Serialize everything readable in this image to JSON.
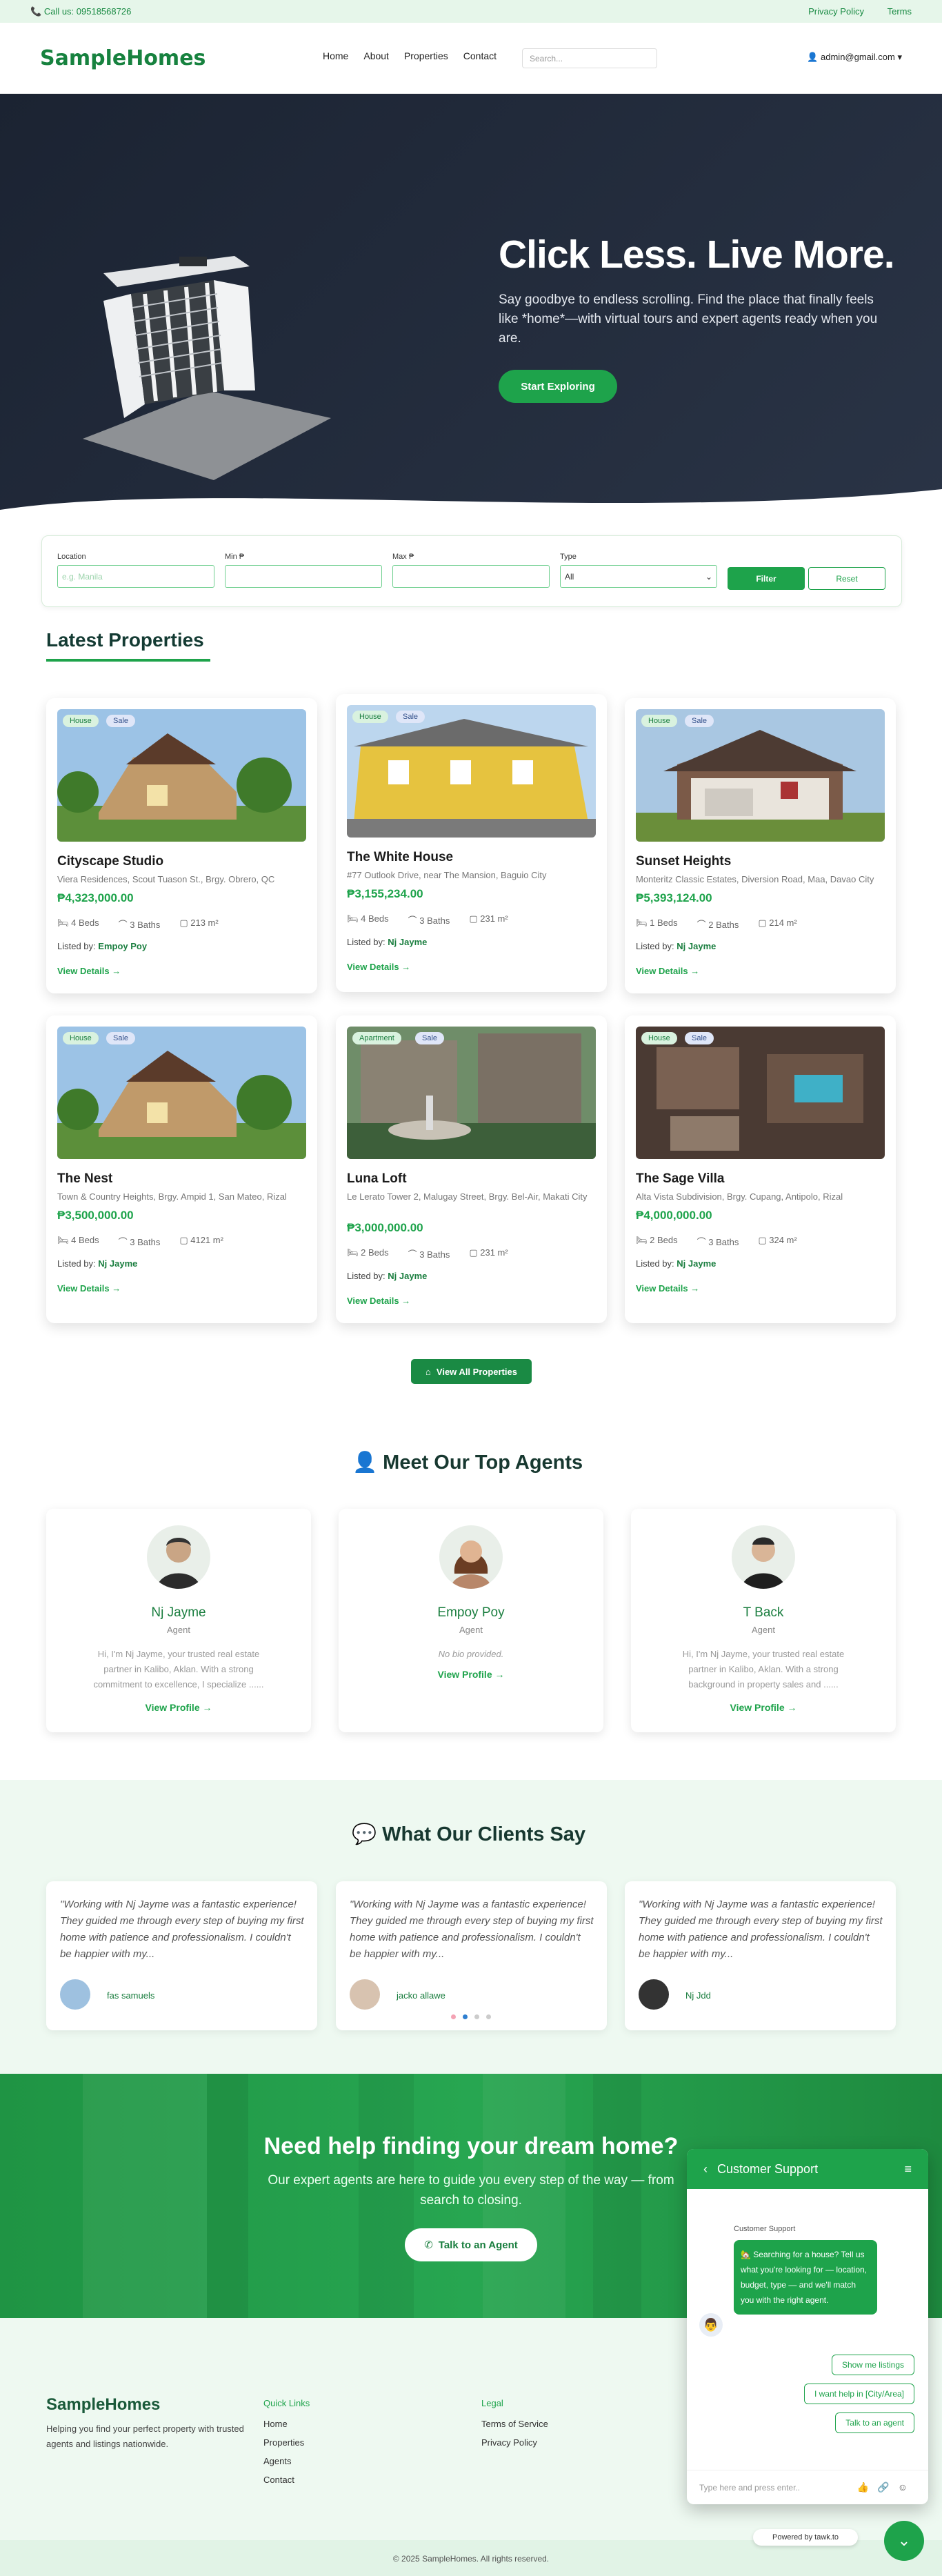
{
  "topbar": {
    "phone": "Call us: 09518568726",
    "links": [
      "Privacy Policy",
      "Terms"
    ]
  },
  "nav": {
    "logo": "SampleHomes",
    "links": [
      "Home",
      "About",
      "Properties",
      "Contact"
    ],
    "search_placeholder": "Search...",
    "user": "admin@gmail.com ▾"
  },
  "hero": {
    "title": "Click Less. Live More.",
    "subtitle": "Say goodbye to endless scrolling. Find the place that finally feels like *home*—with virtual tours and expert agents ready when you are.",
    "cta": "Start Exploring"
  },
  "filter": {
    "location_label": "Location",
    "location_placeholder": "e.g. Manila",
    "min_label": "Min ₱",
    "max_label": "Max ₱",
    "type_label": "Type",
    "type_value": "All",
    "filter_btn": "Filter",
    "reset_btn": "Reset"
  },
  "latest": {
    "title": "Latest Properties",
    "view_all": "View All Properties"
  },
  "properties": [
    {
      "type": "House",
      "deal": "Sale",
      "name": "Cityscape Studio",
      "address": "Viera Residences, Scout Tuason St., Brgy. Obrero, QC",
      "price": "₱4,323,000.00",
      "beds": "4 Beds",
      "baths": "3 Baths",
      "area": "213 m²",
      "lister": "Empoy Poy"
    },
    {
      "type": "House",
      "deal": "Sale",
      "name": "The White House",
      "address": "#77 Outlook Drive, near The Mansion, Baguio City",
      "price": "₱3,155,234.00",
      "beds": "4 Beds",
      "baths": "3 Baths",
      "area": "231 m²",
      "lister": "Nj Jayme"
    },
    {
      "type": "House",
      "deal": "Sale",
      "name": "Sunset Heights",
      "address": "Monteritz Classic Estates, Diversion Road, Maa, Davao City",
      "price": "₱5,393,124.00",
      "beds": "1 Beds",
      "baths": "2 Baths",
      "area": "214 m²",
      "lister": "Nj Jayme"
    },
    {
      "type": "House",
      "deal": "Sale",
      "name": "The Nest",
      "address": "Town & Country Heights, Brgy. Ampid 1, San Mateo, Rizal",
      "price": "₱3,500,000.00",
      "beds": "4 Beds",
      "baths": "3 Baths",
      "area": "4121 m²",
      "lister": "Nj Jayme"
    },
    {
      "type": "Apartment",
      "deal": "Sale",
      "name": "Luna Loft",
      "address": "Le Lerato Tower 2, Malugay Street, Brgy. Bel-Air, Makati City",
      "price": "₱3,000,000.00",
      "beds": "2 Beds",
      "baths": "3 Baths",
      "area": "231 m²",
      "lister": "Nj Jayme"
    },
    {
      "type": "House",
      "deal": "Sale",
      "name": "The Sage Villa",
      "address": "Alta Vista Subdivision, Brgy. Cupang, Antipolo, Rizal",
      "price": "₱4,000,000.00",
      "beds": "2 Beds",
      "baths": "3 Baths",
      "area": "324 m²",
      "lister": "Nj Jayme"
    }
  ],
  "card_common": {
    "listed_by": "Listed by:",
    "view_details": "View Details →"
  },
  "agents_section": {
    "title": "Meet Our Top Agents"
  },
  "agents": [
    {
      "name": "Nj Jayme",
      "role": "Agent",
      "bio": "Hi, I'm Nj Jayme, your trusted real estate partner in Kalibo, Aklan. With a strong commitment to excellence, I specialize ......",
      "link": "View Profile →"
    },
    {
      "name": "Empoy Poy",
      "role": "Agent",
      "bio": "No bio provided.",
      "link": "View Profile →"
    },
    {
      "name": "T Back",
      "role": "Agent",
      "bio": "Hi, I'm Nj Jayme, your trusted real estate partner in Kalibo, Aklan. With a strong background in property sales and ......",
      "link": "View Profile →"
    }
  ],
  "testimonials_section": {
    "title": "What Our Clients Say"
  },
  "testimonials": [
    {
      "quote": "\"Working with Nj Jayme was a fantastic experience! They guided me through every step of buying my first home with patience and professionalism. I couldn't be happier with my...",
      "name": "fas samuels"
    },
    {
      "quote": "\"Working with Nj Jayme was a fantastic experience! They guided me through every step of buying my first home with patience and professionalism. I couldn't be happier with my...",
      "name": "jacko allawe"
    },
    {
      "quote": "\"Working with Nj Jayme was a fantastic experience! They guided me through every step of buying my first home with patience and professionalism. I couldn't be happier with my...",
      "name": "Nj Jdd"
    }
  ],
  "cta_band": {
    "title": "Need help finding your dream home?",
    "text": "Our expert agents are here to guide you every step of the way — from search to closing.",
    "button": "Talk to an Agent"
  },
  "footer": {
    "logo": "SampleHomes",
    "desc": "Helping you find your perfect property with trusted agents and listings nationwide.",
    "quick_title": "Quick Links",
    "quick_links": [
      "Home",
      "Properties",
      "Agents",
      "Contact"
    ],
    "legal_title": "Legal",
    "legal_links": [
      "Terms of Service",
      "Privacy Policy"
    ],
    "copyright": "© 2025 SampleHomes. All rights reserved."
  },
  "chat": {
    "title": "Customer Support",
    "sender": "Customer Support",
    "message": "🏡 Searching for a house? Tell us what you're looking for — location, budget, type — and we'll match you with the right agent.",
    "quick_replies": [
      "Show me listings",
      "I want help in [City/Area]",
      "Talk to an agent"
    ],
    "input_placeholder": "Type here and press enter..",
    "powered": "Powered by tawk.to"
  },
  "colors": {
    "brand": "#1ea34b",
    "dark": "#1b2332"
  }
}
